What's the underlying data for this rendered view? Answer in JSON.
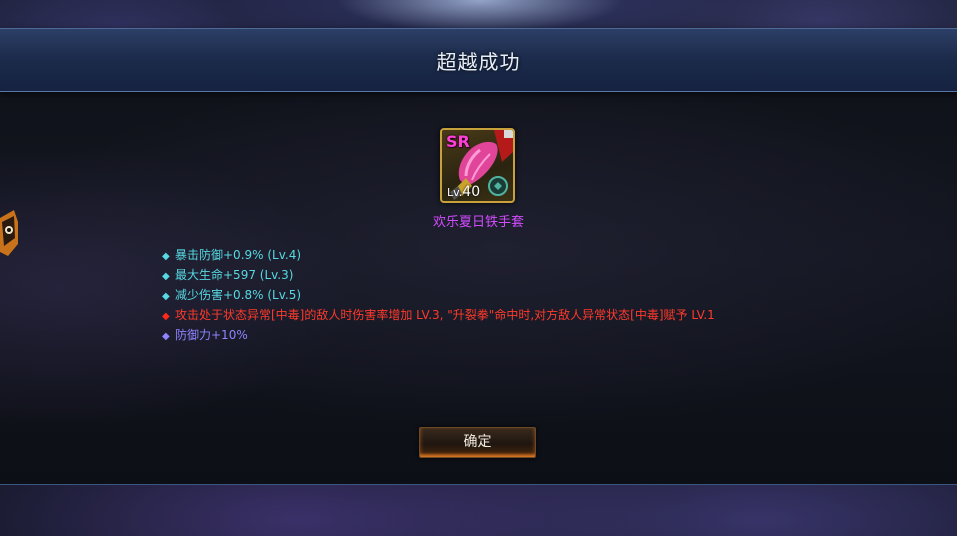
{
  "dialog": {
    "title": "超越成功",
    "confirm_label": "确定"
  },
  "item": {
    "rarity": "SR",
    "level_prefix": "Lv.",
    "level": "40",
    "name": "欢乐夏日铁手套",
    "border_color": "#c7a23c",
    "name_color": "#d14bff"
  },
  "stats": [
    {
      "text": "暴击防御+0.9% (Lv.4)",
      "color": "#56d9e2"
    },
    {
      "text": "最大生命+597 (Lv.3)",
      "color": "#56d9e2"
    },
    {
      "text": "减少伤害+0.8% (Lv.5)",
      "color": "#56d9e2"
    },
    {
      "text": "攻击处于状态异常[中毒]的敌人时伤害率增加 LV.3, \"升裂拳\"命中时,对方敌人异常状态[中毒]赋予 LV.1",
      "color": "#ff3a2a"
    },
    {
      "text": "防御力+10%",
      "color": "#8f84ff"
    }
  ],
  "icons": {
    "stat_bullet": "diamond-icon",
    "item": "glove-icon",
    "lock": "lock-icon"
  }
}
